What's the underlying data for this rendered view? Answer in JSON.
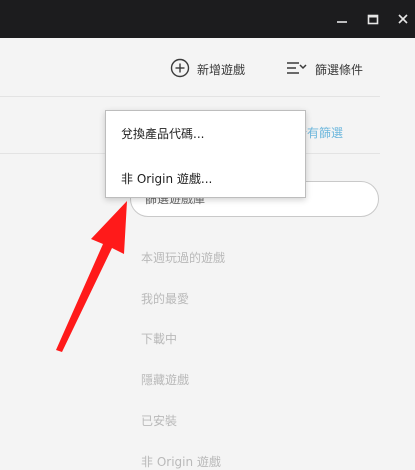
{
  "toolbar": {
    "add_game_label": "新增遊戲",
    "filter_label": "篩選條件",
    "clear_filters_label": "除所有篩選"
  },
  "dropdown": {
    "items": [
      {
        "label": "兌換產品代碼..."
      },
      {
        "label": "非 Origin 遊戲..."
      }
    ]
  },
  "search": {
    "placeholder": "篩選遊戲庫"
  },
  "filters": {
    "items": [
      {
        "label": "本週玩過的遊戲"
      },
      {
        "label": "我的最愛"
      },
      {
        "label": "下載中"
      },
      {
        "label": "隱藏遊戲"
      },
      {
        "label": "已安裝"
      },
      {
        "label": "非 Origin 遊戲"
      }
    ]
  },
  "colors": {
    "titlebar": "#1c1c1e",
    "background": "#f4f4f4",
    "accent_link": "#6fb8dd",
    "annotation_arrow": "#ff1a1a"
  }
}
